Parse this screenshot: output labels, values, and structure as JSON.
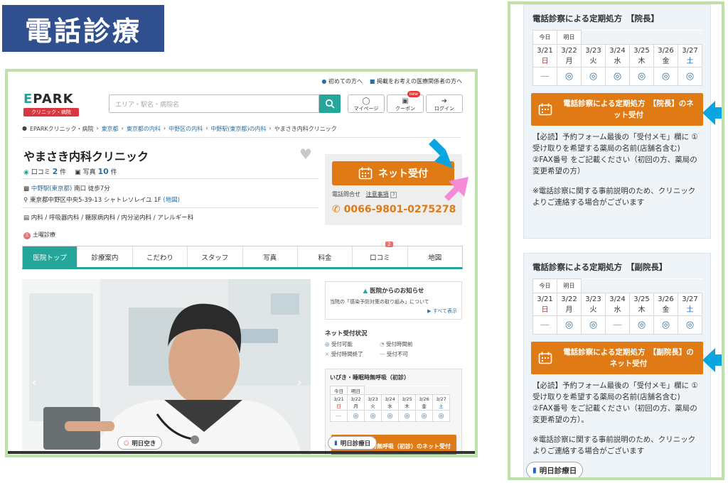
{
  "slide": {
    "title": "電話診療"
  },
  "epark": {
    "toplinks": [
      "初めての方へ",
      "掲載をお考えの医療関係者の方へ"
    ],
    "logo_main": "EPARK",
    "logo_sub": "クリニック・病院",
    "search_placeholder": "エリア・駅名・病院名",
    "header_buttons": [
      {
        "label": "マイページ",
        "icon": "user-icon"
      },
      {
        "label": "クーポン",
        "icon": "coupon-icon",
        "badge": "new"
      },
      {
        "label": "ログイン",
        "icon": "login-icon"
      }
    ],
    "breadcrumb": [
      "EPARKクリニック・病院",
      "東京都",
      "東京都の内科",
      "中野区の内科",
      "中野駅(東京都)の内科",
      "やまさき内科クリニック"
    ],
    "clinic": {
      "name": "やまさき内科クリニック",
      "reviews_label": "口コミ",
      "reviews_count": "2",
      "reviews_unit": "件",
      "photos_label": "写真",
      "photos_count": "10",
      "photos_unit": "件",
      "station": "中野駅(東京都)",
      "station_detail": "南口 徒歩7分",
      "address": "東京都中野区中央5-39-13 シャトレソレイユ 1F",
      "map_link": "(地図)",
      "departments": "内科 / 呼吸器内科 / 糖尿病内科 / 内分泌内科 / アレルギー科",
      "saturday": "土曜診療"
    },
    "net_button": "ネット受付",
    "phone_label": "電話問合せ",
    "notice_label": "注意事項",
    "phone_number": "0066-9801-0275278",
    "tabs": [
      {
        "label": "医院トップ",
        "active": true
      },
      {
        "label": "診療案内"
      },
      {
        "label": "こだわり"
      },
      {
        "label": "スタッフ"
      },
      {
        "label": "写真"
      },
      {
        "label": "料金"
      },
      {
        "label": "口コミ",
        "badge": "2"
      },
      {
        "label": "地図"
      }
    ],
    "news": {
      "title": "医院からのお知らせ",
      "body": "当院の「感染予防対策の取り組み」について",
      "more": "すべて表示"
    },
    "status_title": "ネット受付状況",
    "legend": [
      "受付可能",
      "受付時間前",
      "受付時間終了",
      "受付不可"
    ],
    "left_schedule_title": "いびき・睡眠時無呼吸（初診）",
    "left_schedule_button": "いびき・睡眠時無呼吸（初診）のネット受付",
    "pill_tomorrow_open": "明日空き",
    "pill_tomorrow_day": "明日診療日"
  },
  "schedule": {
    "today": "今日",
    "tomorrow": "明日",
    "dates": [
      "3/21",
      "3/22",
      "3/23",
      "3/24",
      "3/25",
      "3/26",
      "3/27"
    ],
    "days": [
      "日",
      "月",
      "火",
      "水",
      "木",
      "金",
      "土"
    ],
    "marks": [
      "—",
      "◎",
      "◎",
      "◎",
      "◎",
      "◎",
      "◎"
    ],
    "marks_vice": [
      "—",
      "◎",
      "◎",
      "—",
      "◎",
      "◎",
      "◎"
    ]
  },
  "right": {
    "section1": {
      "title": "電話診察による定期処方　【院長】",
      "button": "電話診察による定期処方　【院長】のネット受付",
      "note": "【必読】予約フォーム最後の「受付メモ」欄に ①受け取りを希望する薬局の名前(店舗名含む) ②FAX番号 をご記載ください（初回の方、薬局の変更希望の方）",
      "note2": "※電話診察に関する事前説明のため、クリニックよりご連絡する場合がございます"
    },
    "section2": {
      "title": "電話診察による定期処方　【副院長】",
      "button": "電話診察による定期処方　【副院長】のネット受付",
      "note": "【必読】予約フォーム最後の「受付メモ」欄に ①受け取りを希望する薬局の名前(店舗名含む) ②FAX番号 をご記載ください（初回の方、薬局の変更希望の方）。",
      "note2": "※電話診察に関する事前説明のため、クリニックよりご連絡する場合がございます"
    },
    "pill_tomorrow_day": "明日診療日"
  },
  "colors": {
    "accent_orange": "#e07a14",
    "teal": "#26a69a",
    "frame_green": "#bfe0a8",
    "title_blue": "#2f4f8f",
    "arrow_blue": "#0aa5e0",
    "arrow_pink": "#f58ad8"
  }
}
